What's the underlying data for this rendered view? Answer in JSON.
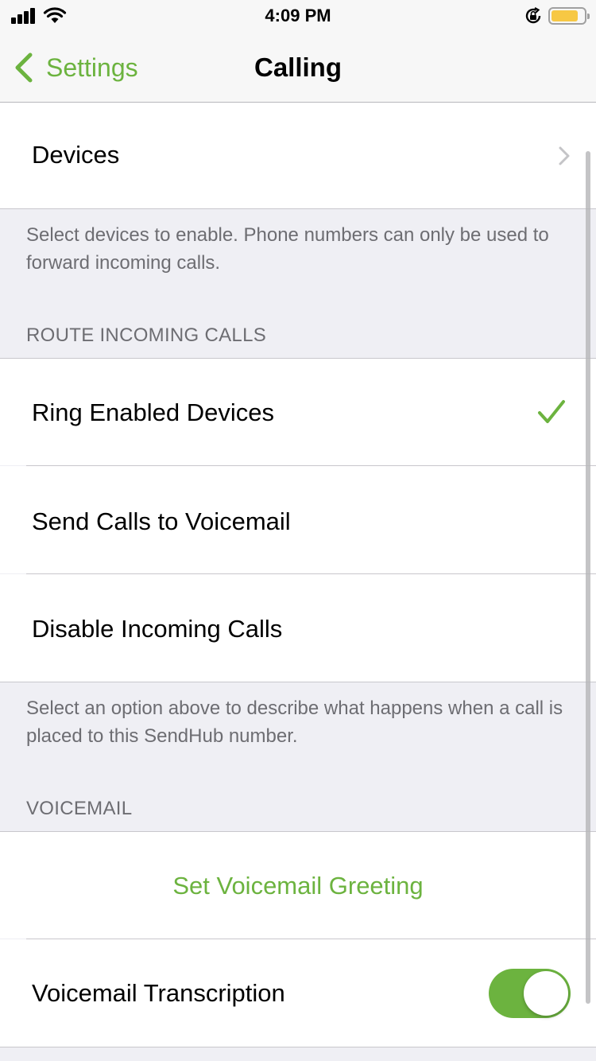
{
  "status_bar": {
    "time": "4:09 PM",
    "signal_icon": "cellular-signal-icon",
    "wifi_icon": "wifi-icon",
    "orientation_lock_icon": "orientation-lock-icon",
    "battery_icon": "battery-icon",
    "battery_fill_percent": 82,
    "battery_color": "#f7c844"
  },
  "nav": {
    "back_label": "Settings",
    "back_icon": "chevron-left-icon",
    "title": "Calling"
  },
  "devices": {
    "label": "Devices",
    "icon": "chevron-right-icon",
    "footer": "Select devices to enable. Phone numbers can only be used to forward incoming calls."
  },
  "route": {
    "header": "ROUTE INCOMING CALLS",
    "options": [
      {
        "label": "Ring Enabled Devices",
        "selected": true
      },
      {
        "label": "Send Calls to Voicemail",
        "selected": false
      },
      {
        "label": "Disable Incoming Calls",
        "selected": false
      }
    ],
    "check_icon": "checkmark-icon",
    "footer": "Select an option above to describe what happens when a call is placed to this SendHub number."
  },
  "voicemail": {
    "header": "VOICEMAIL",
    "greeting_label": "Set Voicemail Greeting",
    "transcription_label": "Voicemail Transcription",
    "transcription_enabled": true
  },
  "colors": {
    "accent": "#6cb33f",
    "toggle_on": "#6cb33f",
    "secondary_text": "#6d6d72",
    "separator": "#c8c7cc",
    "chevron": "#c4c4c7"
  }
}
